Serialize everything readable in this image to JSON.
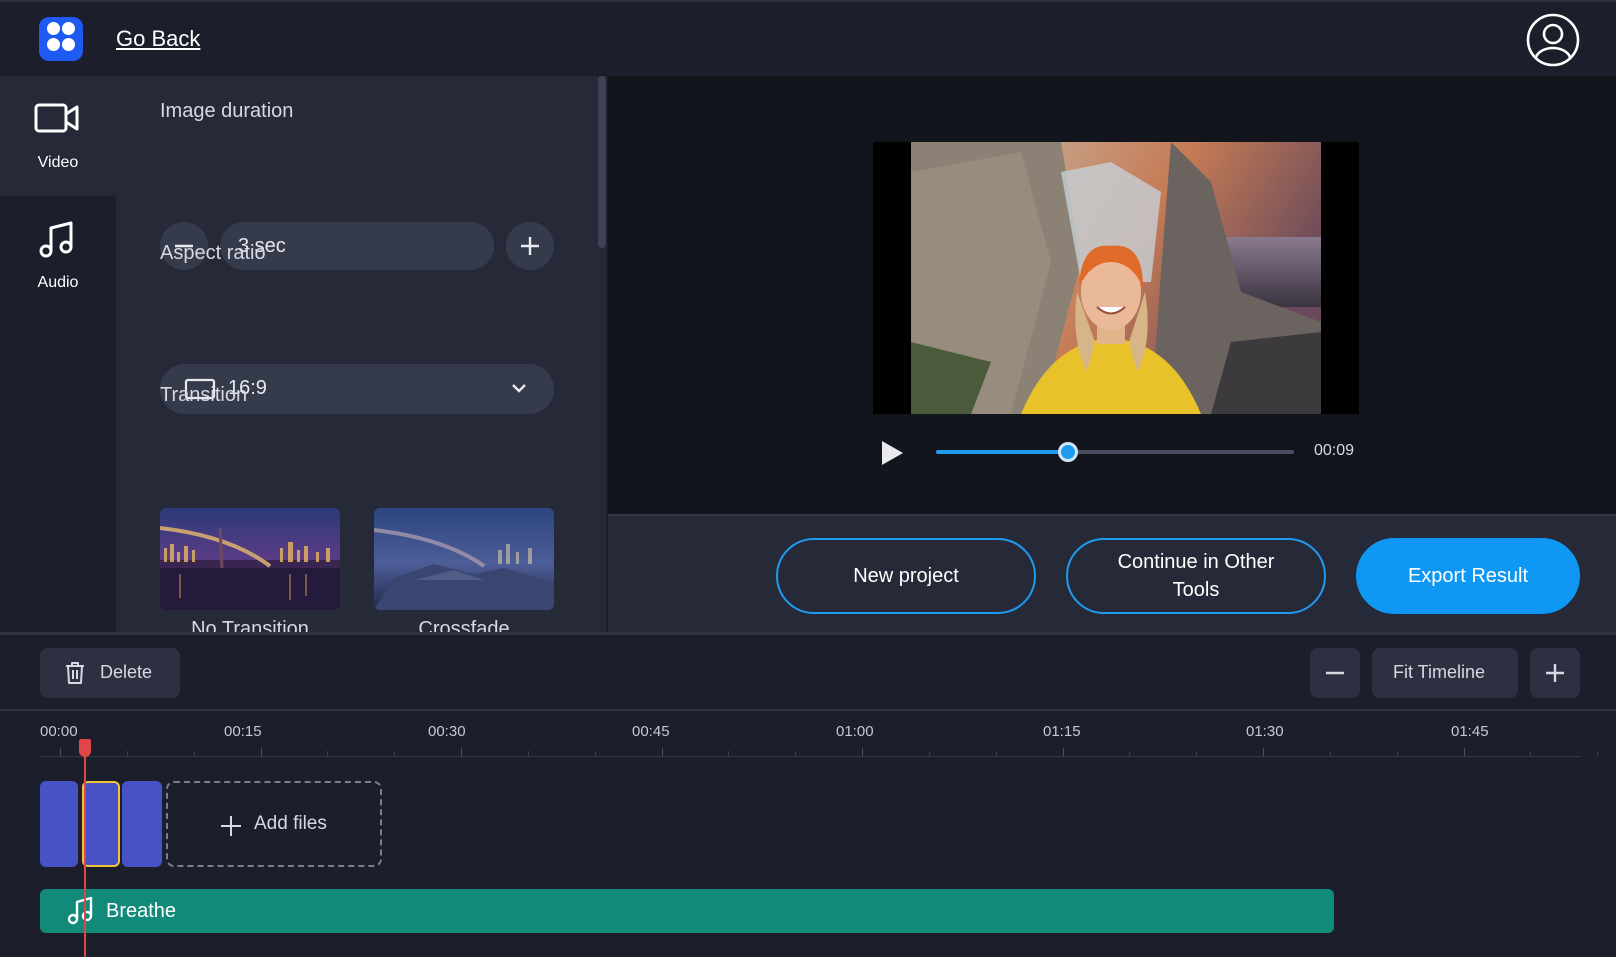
{
  "topbar": {
    "go_back_label": "Go Back",
    "account_icon": "user-circle-icon"
  },
  "rail": {
    "items": [
      {
        "label": "Video",
        "icon": "video-camera-icon"
      },
      {
        "label": "Audio",
        "icon": "music-note-icon"
      }
    ]
  },
  "panel": {
    "image_duration": {
      "title": "Image duration",
      "value": "3 sec"
    },
    "aspect_ratio": {
      "title": "Aspect ratio",
      "value": "16:9"
    },
    "transition": {
      "title": "Transition",
      "options": [
        "No Transition",
        "Crossfade"
      ]
    }
  },
  "preview": {
    "time": "00:09",
    "progress_fraction": 0.37
  },
  "actions": {
    "new_project": "New project",
    "continue_line1": "Continue in Other",
    "continue_line2": "Tools",
    "export": "Export Result"
  },
  "timeline": {
    "delete_label": "Delete",
    "fit_label": "Fit Timeline",
    "ticks": [
      "00:00",
      "00:15",
      "00:30",
      "00:45",
      "01:00",
      "01:15",
      "01:30",
      "01:45"
    ],
    "add_files_label": "Add files",
    "audio_track_name": "Breathe"
  },
  "colors": {
    "accent": "#0f97f4",
    "clip": "#4752c4",
    "audio": "#128a7a",
    "playhead": "#e24545",
    "selected_clip_border": "#f0c23a"
  }
}
